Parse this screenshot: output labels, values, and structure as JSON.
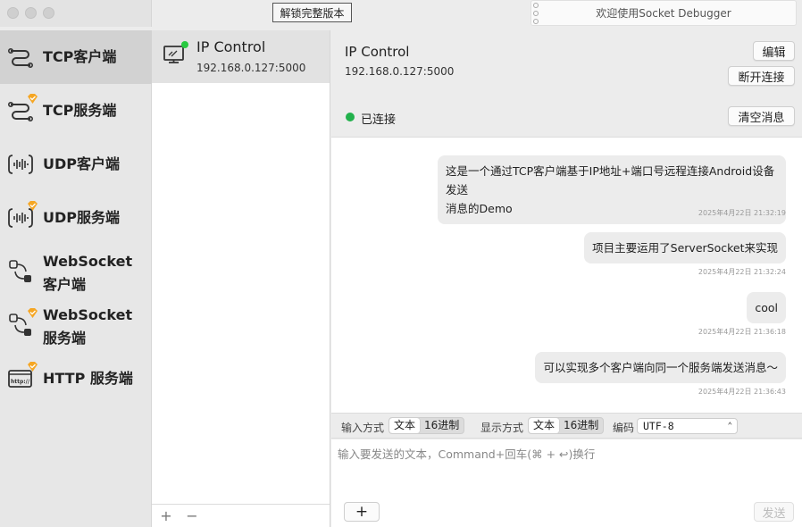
{
  "titlebar": {
    "unlock_button": "解锁完整版本",
    "welcome_text": "欢迎使用Socket Debugger"
  },
  "sidebar": {
    "items": [
      {
        "label": "TCP客户端",
        "icon": "tcp-client-icon",
        "pro": false,
        "active": true
      },
      {
        "label": "TCP服务端",
        "icon": "tcp-server-icon",
        "pro": true,
        "active": false
      },
      {
        "label": "UDP客户端",
        "icon": "udp-client-icon",
        "pro": false,
        "active": false
      },
      {
        "label": "UDP服务端",
        "icon": "udp-server-icon",
        "pro": true,
        "active": false
      },
      {
        "label_line1": "WebSocket",
        "label_line2": "客户端",
        "icon": "websocket-client-icon",
        "pro": false,
        "active": false
      },
      {
        "label_line1": "WebSocket",
        "label_line2": "服务端",
        "icon": "websocket-server-icon",
        "pro": true,
        "active": false
      },
      {
        "label": "HTTP 服务端",
        "icon": "http-server-icon",
        "pro": true,
        "active": false,
        "icon_text": "http://"
      }
    ]
  },
  "connections": [
    {
      "name": "IP Control",
      "address": "192.168.0.127:5000",
      "connected": true
    }
  ],
  "list_footer": {
    "add": "+",
    "remove": "−"
  },
  "header": {
    "title": "IP Control",
    "address": "192.168.0.127:5000",
    "edit_button": "编辑",
    "disconnect_button": "断开连接",
    "status_text": "已连接",
    "clear_button": "清空消息",
    "status_color": "#22b14c"
  },
  "messages": [
    {
      "line1": "这是一个通过TCP客户端基于IP地址+端口号远程连接Android设备发送",
      "line2": "消息的Demo",
      "time": "2025年4月22日 21:32:19"
    },
    {
      "text": "项目主要运用了ServerSocket来实现",
      "time": "2025年4月22日 21:32:24"
    },
    {
      "text": "cool",
      "time": "2025年4月22日 21:36:18"
    },
    {
      "text": "可以实现多个客户端向同一个服务端发送消息～",
      "time": "2025年4月22日 21:36:43"
    }
  ],
  "input_bar": {
    "input_mode_label": "输入方式",
    "display_mode_label": "显示方式",
    "mode_text": "文本",
    "mode_hex": "16进制",
    "encoding_label": "编码",
    "encoding_value": "UTF-8"
  },
  "compose": {
    "placeholder": "输入要发送的文本，Command+回车(⌘ + ↩)换行",
    "add_button": "+",
    "send_button": "发送"
  }
}
